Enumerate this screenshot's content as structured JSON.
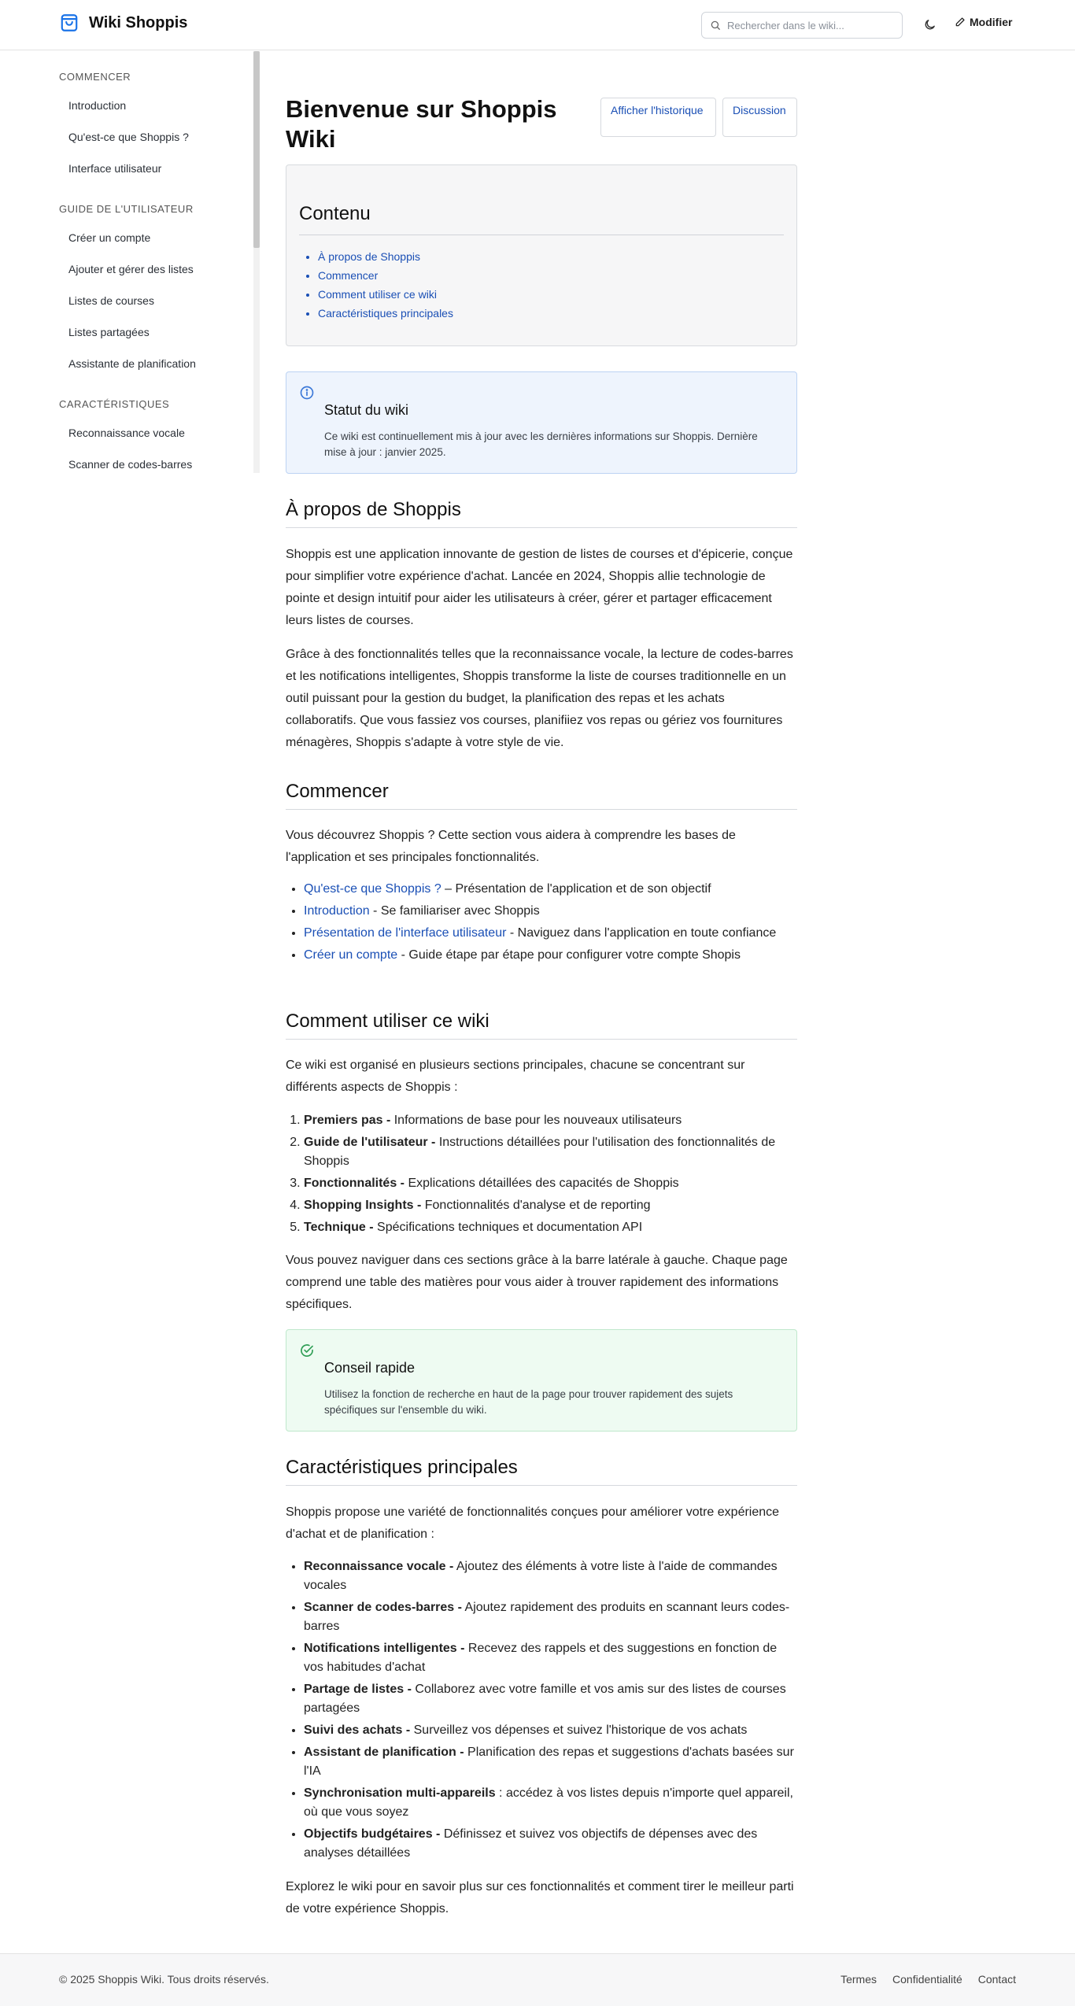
{
  "header": {
    "title": "Wiki Shoppis",
    "search_placeholder": "Rechercher dans le wiki...",
    "edit_label": "Modifier"
  },
  "sidebar": {
    "sections": [
      {
        "heading": "COMMENCER",
        "items": [
          "Introduction",
          "Qu'est-ce que Shoppis ?",
          "Interface utilisateur"
        ]
      },
      {
        "heading": "GUIDE DE L'UTILISATEUR",
        "items": [
          "Créer un compte",
          "Ajouter et gérer des listes",
          "Listes de courses",
          "Listes partagées",
          "Assistante de planification"
        ]
      },
      {
        "heading": "CARACTÉRISTIQUES",
        "items": [
          "Reconnaissance vocale",
          "Scanner de codes-barres"
        ]
      }
    ]
  },
  "page": {
    "title": "Bienvenue sur Shoppis Wiki",
    "history_label": "Afficher l'historique",
    "discussion_label": "Discussion"
  },
  "toc": {
    "title": "Contenu",
    "items": [
      "À propos de Shoppis",
      "Commencer",
      "Comment utiliser ce wiki",
      "Caractéristiques principales"
    ]
  },
  "status_note": {
    "title": "Statut du wiki",
    "text": "Ce wiki est continuellement mis à jour avec les dernières informations sur Shoppis. Dernière mise à jour : janvier 2025."
  },
  "about": {
    "heading": "À propos de Shoppis",
    "p1": "Shoppis est une application innovante de gestion de listes de courses et d'épicerie, conçue pour simplifier votre expérience d'achat. Lancée en 2024, Shoppis allie technologie de pointe et design intuitif pour aider les utilisateurs à créer, gérer et partager efficacement leurs listes de courses.",
    "p2": "Grâce à des fonctionnalités telles que la reconnaissance vocale, la lecture de codes-barres et les notifications intelligentes, Shoppis transforme la liste de courses traditionnelle en un outil puissant pour la gestion du budget, la planification des repas et les achats collaboratifs. Que vous fassiez vos courses, planifiiez vos repas ou gériez vos fournitures ménagères, Shoppis s'adapte à votre style de vie."
  },
  "start": {
    "heading": "Commencer",
    "intro": "Vous découvrez Shoppis ? Cette section vous aidera à comprendre les bases de l'application et ses principales fonctionnalités.",
    "items": [
      {
        "link": "Qu'est-ce que Shoppis ?",
        "desc": " – Présentation de l'application et de son objectif"
      },
      {
        "link": "Introduction",
        "desc": " - Se familiariser avec Shoppis"
      },
      {
        "link": "Présentation de l'interface utilisateur",
        "desc": " - Naviguez dans l'application en toute confiance"
      },
      {
        "link": "Créer un compte",
        "desc": " - Guide étape par étape pour configurer votre compte Shopis"
      }
    ]
  },
  "howto": {
    "heading": "Comment utiliser ce wiki",
    "intro": "Ce wiki est organisé en plusieurs sections principales, chacune se concentrant sur différents aspects de Shoppis :",
    "items": [
      {
        "term": "Premiers pas -",
        "desc": " Informations de base pour les nouveaux utilisateurs"
      },
      {
        "term": "Guide de l'utilisateur -",
        "desc": " Instructions détaillées pour l'utilisation des fonctionnalités de Shoppis"
      },
      {
        "term": "Fonctionnalités -",
        "desc": " Explications détaillées des capacités de Shoppis"
      },
      {
        "term": "Shopping Insights -",
        "desc": " Fonctionnalités d'analyse et de reporting"
      },
      {
        "term": "Technique -",
        "desc": " Spécifications techniques et documentation API"
      }
    ],
    "outro": "Vous pouvez naviguer dans ces sections grâce à la barre latérale à gauche. Chaque page comprend une table des matières pour vous aider à trouver rapidement des informations spécifiques."
  },
  "tip_note": {
    "title": "Conseil rapide",
    "text": "Utilisez la fonction de recherche en haut de la page pour trouver rapidement des sujets spécifiques sur l'ensemble du wiki."
  },
  "features": {
    "heading": "Caractéristiques principales",
    "intro": "Shoppis propose une variété de fonctionnalités conçues pour améliorer votre expérience d'achat et de planification :",
    "items": [
      {
        "term": "Reconnaissance vocale -",
        "desc": " Ajoutez des éléments à votre liste à l'aide de commandes vocales"
      },
      {
        "term": "Scanner de codes-barres -",
        "desc": " Ajoutez rapidement des produits en scannant leurs codes-barres"
      },
      {
        "term": "Notifications intelligentes -",
        "desc": " Recevez des rappels et des suggestions en fonction de vos habitudes d'achat"
      },
      {
        "term": "Partage de listes -",
        "desc": " Collaborez avec votre famille et vos amis sur des listes de courses partagées"
      },
      {
        "term": "Suivi des achats -",
        "desc": " Surveillez vos dépenses et suivez l'historique de vos achats"
      },
      {
        "term": "Assistant de planification -",
        "desc": " Planification des repas et suggestions d'achats basées sur l'IA"
      },
      {
        "term": "Synchronisation multi-appareils",
        "desc": " : accédez à vos listes depuis n'importe quel appareil, où que vous soyez"
      },
      {
        "term": "Objectifs budgétaires -",
        "desc": " Définissez et suivez vos objectifs de dépenses avec des analyses détaillées"
      }
    ],
    "outro": "Explorez le wiki pour en savoir plus sur ces fonctionnalités et comment tirer le meilleur parti de votre expérience Shoppis."
  },
  "footer": {
    "copyright": "© 2025 Shoppis Wiki. Tous droits réservés.",
    "links": [
      "Termes",
      "Confidentialité",
      "Contact"
    ]
  },
  "colors": {
    "accent": "#1a4fb5",
    "info_bg": "#eef4fd",
    "info_border": "#bcd3f3",
    "tip_bg": "#eefbf2",
    "tip_border": "#bfe8cc"
  }
}
